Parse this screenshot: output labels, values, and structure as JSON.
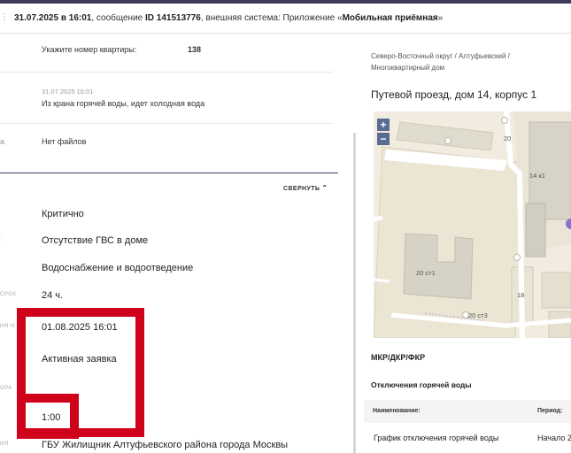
{
  "header": {
    "datetime": "31.07.2025 в 16:01",
    "message_prefix": ", сообщение ",
    "message_id": "ID 141513776",
    "system_prefix": ", внешняя система: Приложение «",
    "system_name": "Мобильная приёмная",
    "system_suffix": "»"
  },
  "details": {
    "apartment_label": "Укажите номер квартиры:",
    "apartment_value": "138",
    "comment_date": "31.07.2025 16:01",
    "comment_text": "Из крана горячей воды, идет холодная вода",
    "files_text": "Нет файлов",
    "collapse_label": "СВЕРНУТЬ"
  },
  "fields": {
    "priority": "Критично",
    "problem": "Отсутствие ГВС в доме",
    "category": "Водоснабжение и водоотведение",
    "term_label": "СРОК",
    "term": "24 ч.",
    "deadline_label": "ИЯ Н",
    "deadline": "01.08.2025 16:01",
    "status": "Активная заявка",
    "executor_label": "ОРА",
    "timer": "1:00",
    "org_label": "ИЯ",
    "organization": "ГБУ Жилищник Алтуфьевского района города Москвы"
  },
  "location": {
    "breadcrumb": "Северо-Восточный округ / Алтуфьевский / Многоквартирный дом",
    "address": "Путевой проезд, дом 14, корпус 1",
    "map": {
      "zoom_in": "+",
      "zoom_out": "−",
      "labels": [
        "20",
        "14 к1",
        "20 ст1",
        "20 ст3",
        "18"
      ],
      "marker_color": "#8a6fd6"
    }
  },
  "sections": {
    "mkr": "МКР/ДКР/ФКР",
    "hot_water": "Отключения горячей воды",
    "table": {
      "headers": [
        "Наименование:",
        "Период:"
      ],
      "rows": [
        [
          "График отключения горячей воды",
          "Начало 2"
        ]
      ]
    }
  },
  "colors": {
    "accent": "#3d3a5c",
    "highlight": "#d0021b"
  }
}
